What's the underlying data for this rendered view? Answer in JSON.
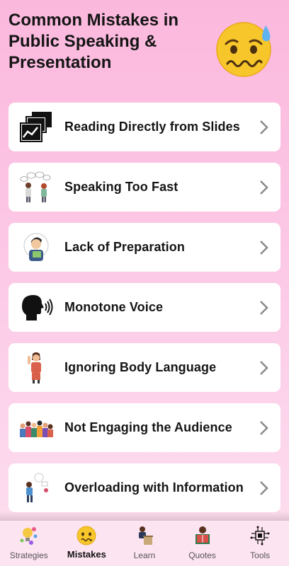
{
  "page": {
    "title": "Common Mistakes in Public Speaking & Presentation",
    "header_icon": "anxious-face-emoji"
  },
  "mistakes": [
    {
      "label": "Reading Directly from Slides",
      "icon": "slides-chart-icon"
    },
    {
      "label": "Speaking Too Fast",
      "icon": "fast-speakers-illustration"
    },
    {
      "label": "Lack of Preparation",
      "icon": "unprepared-student-illustration"
    },
    {
      "label": "Monotone Voice",
      "icon": "speaking-head-icon"
    },
    {
      "label": "Ignoring Body Language",
      "icon": "gesturing-woman-illustration"
    },
    {
      "label": "Not Engaging the Audience",
      "icon": "audience-crowd-illustration"
    },
    {
      "label": "Overloading with Information",
      "icon": "overloaded-person-illustration"
    }
  ],
  "nav": {
    "items": [
      {
        "label": "Strategies",
        "icon": "lightbulb-ideas-icon",
        "active": false
      },
      {
        "label": "Mistakes",
        "icon": "anxious-face-icon",
        "active": true
      },
      {
        "label": "Learn",
        "icon": "teacher-podium-icon",
        "active": false
      },
      {
        "label": "Quotes",
        "icon": "book-reader-icon",
        "active": false
      },
      {
        "label": "Tools",
        "icon": "ai-chip-icon",
        "active": false
      }
    ]
  },
  "colors": {
    "background_top": "#fbb8dd",
    "background_bottom": "#fde0f0",
    "card": "#ffffff",
    "text": "#151515",
    "chevron": "#8a8a8a",
    "nav_bg": "#fde4f1"
  }
}
